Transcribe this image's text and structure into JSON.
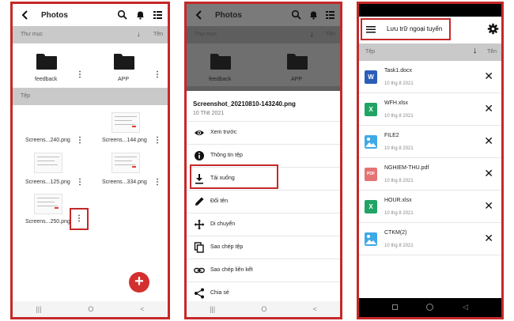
{
  "panel1": {
    "title": "Photos",
    "folders_header": "Thư mục",
    "sort_label": "Tên",
    "folders": [
      {
        "name": "feedback"
      },
      {
        "name": "APP"
      }
    ],
    "files_header": "Tệp",
    "files": [
      {
        "name": "Screens...240.png"
      },
      {
        "name": "Screens...144.png"
      },
      {
        "name": "Screens...125.png"
      },
      {
        "name": "Screens...334.png"
      },
      {
        "name": "Screens...250.png"
      }
    ],
    "fab_label": "+",
    "nav": [
      "|||",
      "O",
      "<"
    ]
  },
  "panel2": {
    "title": "Photos",
    "folders_header": "Thư mục",
    "sort_label": "Tên",
    "folders": [
      {
        "name": "feedback"
      },
      {
        "name": "APP"
      }
    ],
    "sheet_title": "Screenshot_20210810-143240.png",
    "sheet_date": "10 Th8 2021",
    "menu": [
      {
        "label": "Xem trước",
        "icon": "eye-icon"
      },
      {
        "label": "Thông tin tệp",
        "icon": "info-icon"
      },
      {
        "label": "Tải xuống",
        "icon": "download-icon"
      },
      {
        "label": "Đổi tên",
        "icon": "pencil-icon"
      },
      {
        "label": "Di chuyển",
        "icon": "move-icon"
      },
      {
        "label": "Sao chép tệp",
        "icon": "copy-icon"
      },
      {
        "label": "Sao chép liên kết",
        "icon": "link-icon"
      },
      {
        "label": "Chia sẻ",
        "icon": "share-icon"
      }
    ],
    "nav": [
      "|||",
      "O",
      "<"
    ]
  },
  "panel3": {
    "title": "Lưu trữ ngoại tuyến",
    "files_header": "Tệp",
    "sort_label": "Tên",
    "files": [
      {
        "name": "Task1.docx",
        "date": "10 thg 8 2021",
        "type": "word",
        "color": "#2b5eb7",
        "glyph": "W"
      },
      {
        "name": "WFH.xlsx",
        "date": "10 thg 8 2021",
        "type": "excel",
        "color": "#21a366",
        "glyph": "X"
      },
      {
        "name": "FILE2",
        "date": "10 thg 8 2021",
        "type": "image",
        "color": "#3fa9e8",
        "glyph": ""
      },
      {
        "name": "NGHIEM-THU.pdf",
        "date": "10 thg 8 2021",
        "type": "pdf",
        "color": "#e57373",
        "glyph": "PDF"
      },
      {
        "name": "HOUR.xlsx",
        "date": "10 thg 8 2021",
        "type": "excel",
        "color": "#21a366",
        "glyph": "X"
      },
      {
        "name": "CTKM(2)",
        "date": "10 thg 8 2021",
        "type": "image",
        "color": "#3fa9e8",
        "glyph": ""
      }
    ],
    "remove_glyph": "✕"
  },
  "colors": {
    "highlight": "#c62828",
    "fab": "#d32f2f",
    "section": "#c9c9c9"
  }
}
